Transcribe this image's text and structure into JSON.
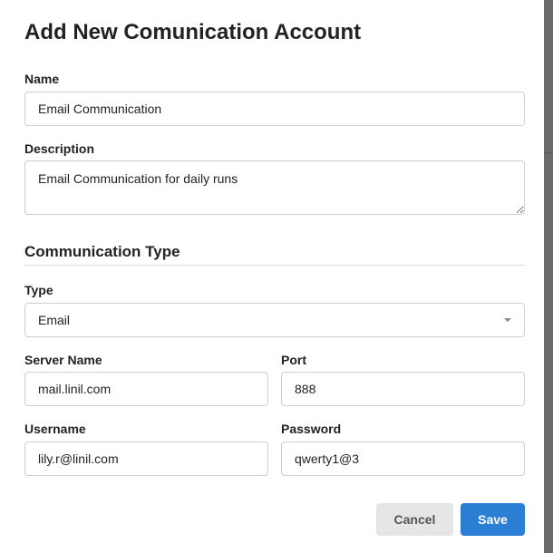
{
  "dialog": {
    "title": "Add New Comunication Account"
  },
  "form": {
    "name": {
      "label": "Name",
      "value": "Email Communication"
    },
    "description": {
      "label": "Description",
      "value": "Email Communication for daily runs"
    },
    "section_title": "Communication Type",
    "type": {
      "label": "Type",
      "selected": "Email"
    },
    "server_name": {
      "label": "Server Name",
      "value": "mail.linil.com"
    },
    "port": {
      "label": "Port",
      "value": "888"
    },
    "username": {
      "label": "Username",
      "value": "lily.r@linil.com"
    },
    "password": {
      "label": "Password",
      "value": "qwerty1@3"
    }
  },
  "actions": {
    "cancel_label": "Cancel",
    "save_label": "Save"
  },
  "colors": {
    "primary": "#2a7fd4",
    "secondary_button": "#e6e6e6",
    "border": "#cfcfcf",
    "overlay": "#6b6b6b"
  }
}
